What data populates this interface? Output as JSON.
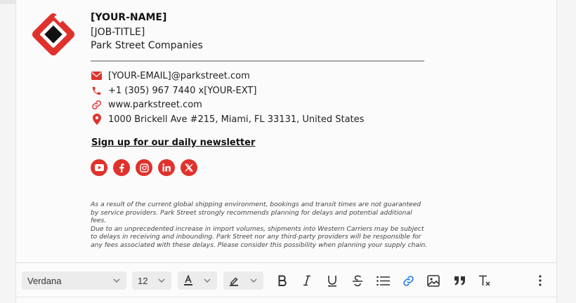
{
  "signature": {
    "name": "[YOUR-NAME]",
    "job_title": "[JOB-TITLE]",
    "company": "Park Street Companies",
    "contacts": [
      {
        "icon": "envelope-icon",
        "text": "[YOUR-EMAIL]@parkstreet.com"
      },
      {
        "icon": "phone-icon",
        "text": "+1 (305) 967 7440 x[YOUR-EXT]"
      },
      {
        "icon": "link-icon",
        "text": "www.parkstreet.com"
      },
      {
        "icon": "map-pin-icon",
        "text": "1000 Brickell Ave #215, Miami, FL 33131, United States"
      }
    ],
    "newsletter_link": "Sign up for our daily newsletter",
    "social_icons": [
      "youtube-icon",
      "facebook-icon",
      "instagram-icon",
      "linkedin-icon",
      "x-icon"
    ],
    "disclaimer": [
      "As a result of the current global shipping environment, bookings and transit times are not guaranteed by service providers. Park Street strongly recommends planning for delays and potential additional fees.",
      "Due to an unprecedented increase in import volumes, shipments into Western Carriers may be subject to delays in receiving and inbounding. Park Street nor any third-party providers will be responsible for any fees associated with these delays. Please consider this possibility when planning your supply chain."
    ]
  },
  "toolbar": {
    "font_family": "Verdana",
    "font_size": "12",
    "buttons": [
      "text-color",
      "highlight-color",
      "bold",
      "italic",
      "underline",
      "strikethrough",
      "bulleted-list",
      "insert-link",
      "insert-image",
      "quote",
      "clear-formatting",
      "more-options"
    ]
  },
  "colors": {
    "brand_red": "#e0322c",
    "link_blue": "#1a73e8",
    "panel_bg": "#fbfbfb"
  }
}
